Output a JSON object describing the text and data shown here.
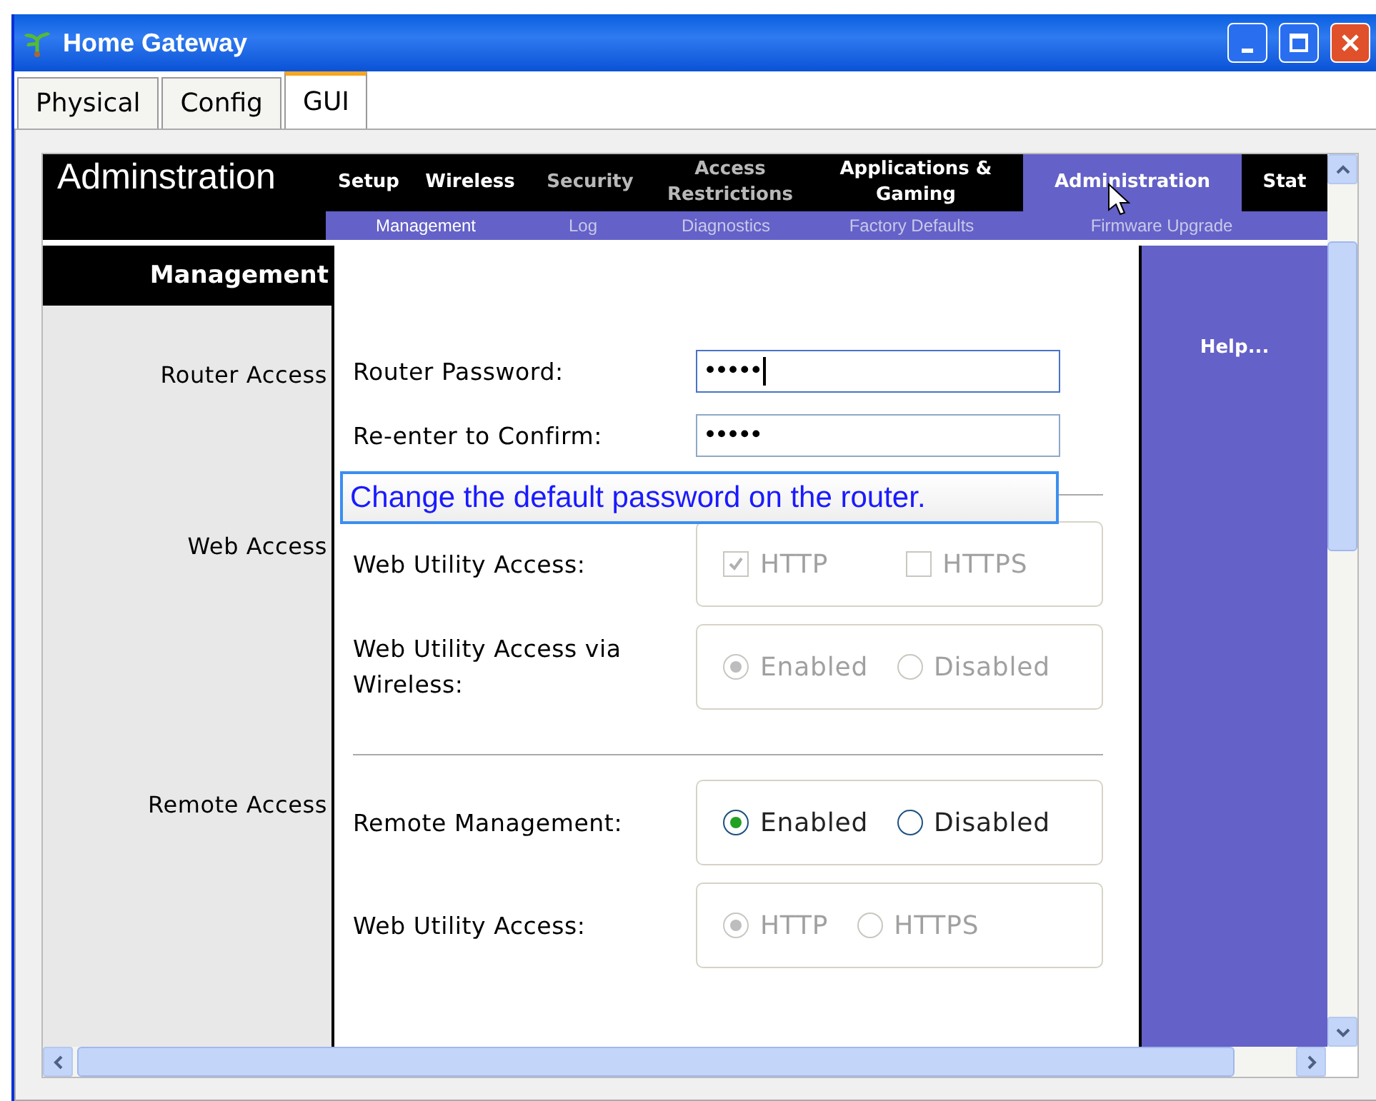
{
  "window": {
    "title": "Home Gateway"
  },
  "tabs": [
    {
      "label": "Physical",
      "selected": false
    },
    {
      "label": "Config",
      "selected": false
    },
    {
      "label": "GUI",
      "selected": true
    }
  ],
  "page": {
    "title": "Adminstration",
    "nav": [
      {
        "label": "Setup",
        "selected": false,
        "dimmed": false
      },
      {
        "label": "Wireless",
        "selected": false,
        "dimmed": false
      },
      {
        "label": "Security",
        "selected": false,
        "dimmed": true
      },
      {
        "label": "Access Restrictions",
        "selected": false,
        "dimmed": true
      },
      {
        "label": "Applications & Gaming",
        "selected": false,
        "dimmed": false
      },
      {
        "label": "Administration",
        "selected": true,
        "dimmed": false
      },
      {
        "label": "Stat",
        "selected": false,
        "dimmed": false
      }
    ],
    "subnav": [
      {
        "label": "Management",
        "selected": true
      },
      {
        "label": "Log",
        "selected": false
      },
      {
        "label": "Diagnostics",
        "selected": false
      },
      {
        "label": "Factory Defaults",
        "selected": false
      },
      {
        "label": "Firmware Upgrade",
        "selected": false
      }
    ],
    "sidebar_title": "Management",
    "help": "Help...",
    "sections": [
      {
        "label": "Router Access",
        "rows": [
          {
            "kind": "password",
            "label": "Router Password:",
            "value": "•••••",
            "focused": true
          },
          {
            "kind": "password",
            "label": "Re-enter to Confirm:",
            "value": "•••••",
            "focused": false
          }
        ]
      },
      {
        "label": "Web Access",
        "rows": [
          {
            "kind": "checkbox",
            "label": "Web Utility Access:",
            "options": [
              {
                "label": "HTTP",
                "checked": true,
                "disabled": true
              },
              {
                "label": "HTTPS",
                "checked": false,
                "disabled": true
              }
            ]
          },
          {
            "kind": "radio",
            "label": "Web Utility Access via Wireless:",
            "options": [
              {
                "label": "Enabled",
                "selected": true,
                "disabled": true
              },
              {
                "label": "Disabled",
                "selected": false,
                "disabled": true
              }
            ]
          }
        ]
      },
      {
        "label": "Remote Access",
        "rows": [
          {
            "kind": "radio",
            "label": "Remote Management:",
            "options": [
              {
                "label": "Enabled",
                "selected": true,
                "disabled": false
              },
              {
                "label": "Disabled",
                "selected": false,
                "disabled": false
              }
            ]
          },
          {
            "kind": "radio",
            "label": "Web Utility Access:",
            "options": [
              {
                "label": "HTTP",
                "selected": true,
                "disabled": true
              },
              {
                "label": "HTTPS",
                "selected": false,
                "disabled": true
              }
            ]
          }
        ]
      }
    ],
    "tooltip": {
      "text": "Change the default password on the router."
    }
  }
}
